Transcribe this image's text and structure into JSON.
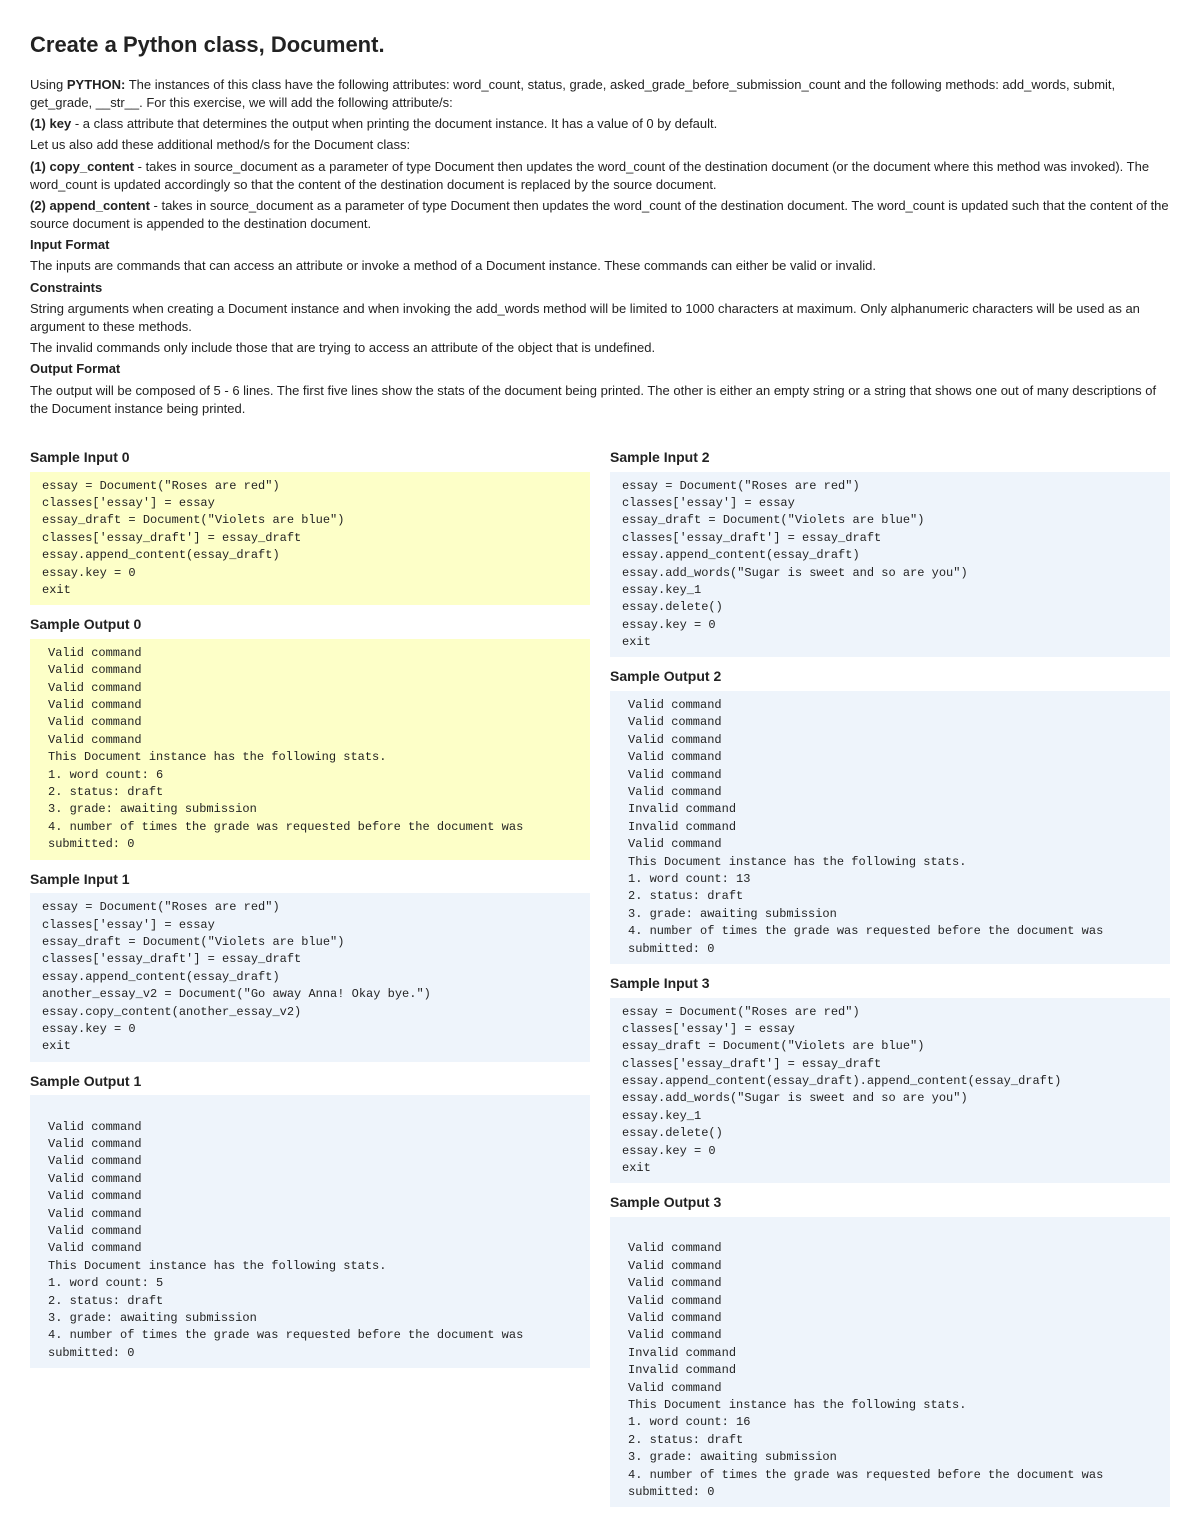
{
  "title": "Create a Python class, Document.",
  "intro": {
    "line1_pre": "Using ",
    "line1_bold": "PYTHON:",
    "line1_post": " The instances of this class have the following attributes: word_count, status, grade, asked_grade_before_submission_count and the following methods: add_words, submit, get_grade, __str__. For this exercise, we will add the following attribute/s:",
    "attr1_bold": "(1) key",
    "attr1_text": " - a class attribute that determines the output when printing the document instance. It has a value of 0 by default.",
    "line3": "Let us also add these additional method/s for the Document class:",
    "method1_bold": "(1) copy_content",
    "method1_text": " - takes in source_document as a parameter of type Document then updates the word_count of the destination document (or the document where this method was invoked). The word_count is updated accordingly so that the content of the destination document is replaced by the source document.",
    "method2_bold": "(2) append_content",
    "method2_text": " - takes in source_document as a parameter of type Document then updates the word_count of the destination document. The word_count is updated such that the content of the source document is appended to the destination document."
  },
  "input_format": {
    "label": "Input Format",
    "text": "The inputs are commands that can access an attribute or invoke a method of a Document instance. These commands can either be valid or invalid."
  },
  "constraints": {
    "label": "Constraints",
    "text1": "String arguments when creating a Document instance and when invoking the add_words method will be limited to 1000 characters at maximum. Only alphanumeric characters will be used as an argument to these methods.",
    "text2": "The invalid commands only include those that are trying to access an attribute of the object that is undefined."
  },
  "output_format": {
    "label": "Output Format",
    "text": "The output will be composed of 5 - 6 lines. The first five lines show the stats of the document being printed. The other is either an empty string or a string that shows one out of many descriptions of the Document instance being printed."
  },
  "samples": {
    "left": [
      {
        "input_label": "Sample Input 0",
        "input_style": "code-yellow",
        "input_text": "essay = Document(\"Roses are red\")\nclasses['essay'] = essay\nessay_draft = Document(\"Violets are blue\")\nclasses['essay_draft'] = essay_draft\nessay.append_content(essay_draft)\nessay.key = 0\nexit",
        "output_label": "Sample Output 0",
        "output_style": "code-yellow output-indent",
        "output_text": "Valid command\nValid command\nValid command\nValid command\nValid command\nValid command\nThis Document instance has the following stats.\n1. word count: 6\n2. status: draft\n3. grade: awaiting submission\n4. number of times the grade was requested before the document was submitted: 0"
      },
      {
        "input_label": "Sample Input 1",
        "input_style": "code-blue",
        "input_text": "essay = Document(\"Roses are red\")\nclasses['essay'] = essay\nessay_draft = Document(\"Violets are blue\")\nclasses['essay_draft'] = essay_draft\nessay.append_content(essay_draft)\nanother_essay_v2 = Document(\"Go away Anna! Okay bye.\")\nessay.copy_content(another_essay_v2)\nessay.key = 0\nexit",
        "output_label": "Sample Output 1",
        "output_style": "code-blue output-indent",
        "output_text": "\nValid command\nValid command\nValid command\nValid command\nValid command\nValid command\nValid command\nValid command\nThis Document instance has the following stats.\n1. word count: 5\n2. status: draft\n3. grade: awaiting submission\n4. number of times the grade was requested before the document was submitted: 0"
      }
    ],
    "right": [
      {
        "input_label": "Sample Input 2",
        "input_style": "code-blue",
        "input_text": "essay = Document(\"Roses are red\")\nclasses['essay'] = essay\nessay_draft = Document(\"Violets are blue\")\nclasses['essay_draft'] = essay_draft\nessay.append_content(essay_draft)\nessay.add_words(\"Sugar is sweet and so are you\")\nessay.key_1\nessay.delete()\nessay.key = 0\nexit",
        "output_label": "Sample Output 2",
        "output_style": "code-blue output-indent",
        "output_text": "Valid command\nValid command\nValid command\nValid command\nValid command\nValid command\nInvalid command\nInvalid command\nValid command\nThis Document instance has the following stats.\n1. word count: 13\n2. status: draft\n3. grade: awaiting submission\n4. number of times the grade was requested before the document was submitted: 0"
      },
      {
        "input_label": "Sample Input 3",
        "input_style": "code-blue",
        "input_text": "essay = Document(\"Roses are red\")\nclasses['essay'] = essay\nessay_draft = Document(\"Violets are blue\")\nclasses['essay_draft'] = essay_draft\nessay.append_content(essay_draft).append_content(essay_draft)\nessay.add_words(\"Sugar is sweet and so are you\")\nessay.key_1\nessay.delete()\nessay.key = 0\nexit",
        "output_label": "Sample Output 3",
        "output_style": "code-blue output-indent",
        "output_text": "\nValid command\nValid command\nValid command\nValid command\nValid command\nValid command\nInvalid command\nInvalid command\nValid command\nThis Document instance has the following stats.\n1. word count: 16\n2. status: draft\n3. grade: awaiting submission\n4. number of times the grade was requested before the document was submitted: 0"
      }
    ]
  }
}
